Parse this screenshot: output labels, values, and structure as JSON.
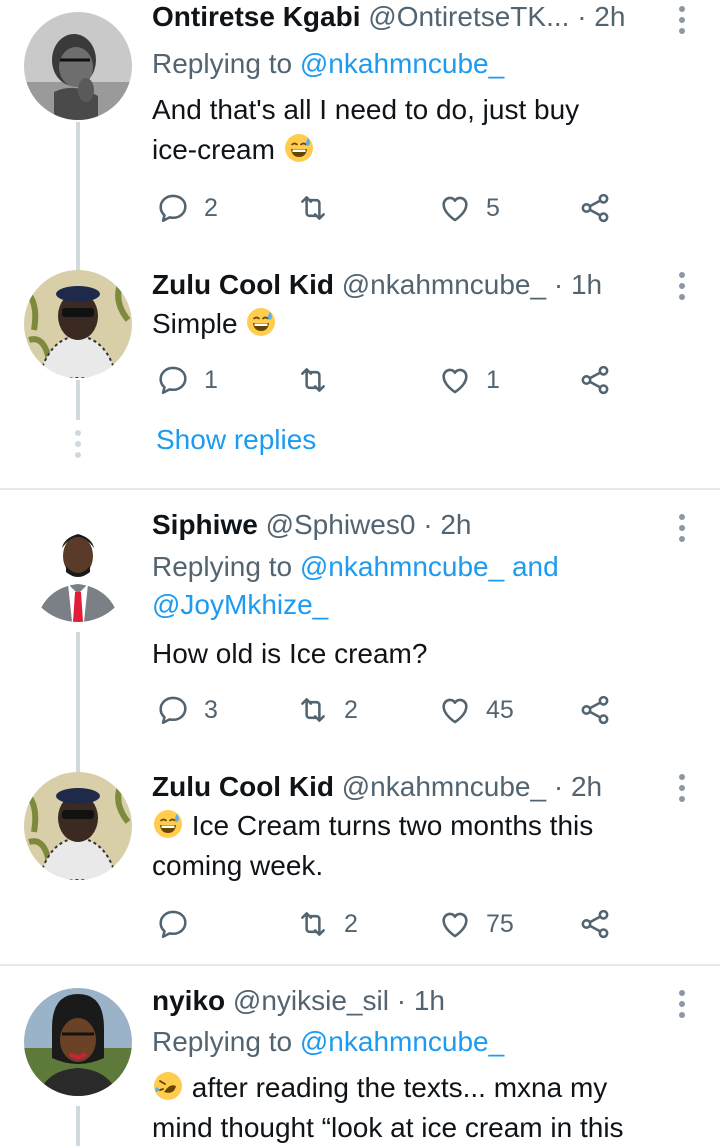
{
  "colors": {
    "accent": "#1d9bf0",
    "muted": "#536471",
    "line": "#cfd9de"
  },
  "icons": {
    "reply": "reply-icon",
    "retweet": "retweet-icon",
    "like": "heart-icon",
    "share": "share-icon",
    "more": "more-icon"
  },
  "tweets": [
    {
      "name": "Ontiretse Kgabi",
      "handle": "@OntiretseTK...",
      "dot": "·",
      "time": "2h",
      "reply_prefix": "Replying to",
      "reply_mentions": "@nkahmncube_",
      "text_line1": "And that's all I need to do, just buy",
      "text_line2": "ice-cream",
      "replies": "2",
      "retweets": "",
      "likes": "5"
    },
    {
      "name": "Zulu Cool Kid",
      "handle": "@nkahmncube_",
      "dot": "·",
      "time": "1h",
      "text_line1": "Simple",
      "replies": "1",
      "retweets": "",
      "likes": "1",
      "show_replies": "Show replies"
    },
    {
      "name": "Siphiwe",
      "handle": "@Sphiwes0",
      "dot": "·",
      "time": "2h",
      "reply_prefix": "Replying to",
      "reply_mentions": "@nkahmncube_ and",
      "reply_mentions2": "@JoyMkhize_",
      "text_line1": "How old is Ice cream?",
      "replies": "3",
      "retweets": "2",
      "likes": "45"
    },
    {
      "name": "Zulu Cool Kid",
      "handle": "@nkahmncube_",
      "dot": "·",
      "time": "2h",
      "text_line1": "Ice Cream turns two months this",
      "text_line2": "coming week.",
      "replies": "",
      "retweets": "2",
      "likes": "75"
    },
    {
      "name": "nyiko",
      "handle": "@nyiksie_sil",
      "dot": "·",
      "time": "1h",
      "reply_prefix": "Replying to",
      "reply_mentions": "@nkahmncube_",
      "text_line1": "after reading the texts... mxna my",
      "text_line2": "mind thought “look at ice cream in this"
    }
  ]
}
